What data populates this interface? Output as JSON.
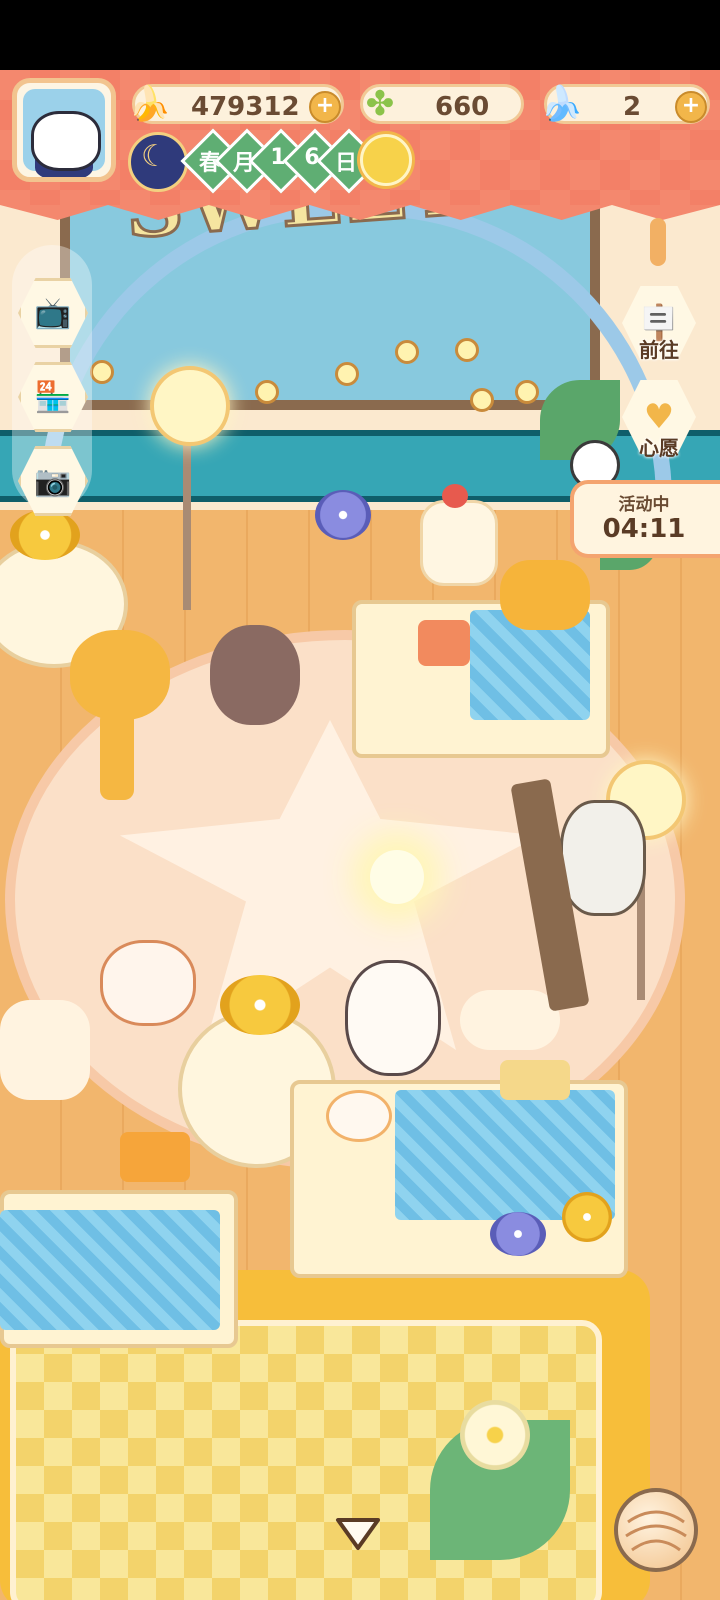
{
  "hud": {
    "avatar_icon": "cat-avatar-icon",
    "currencies": [
      {
        "name": "banana",
        "icon": "banana-icon",
        "value": "479312",
        "has_plus": true
      },
      {
        "name": "clover",
        "icon": "clover-icon",
        "value": "660",
        "has_plus": false
      },
      {
        "name": "blue-banana",
        "icon": "blue-banana-icon",
        "value": "2",
        "has_plus": true
      }
    ],
    "plus_label": "+",
    "date": {
      "season": "春",
      "month_label": "月",
      "day_digit_1": "1",
      "day_digit_2": "6",
      "day_label": "日",
      "weather_icon": "sun-icon"
    }
  },
  "left_menu": [
    {
      "name": "tv-video-button",
      "icon": "tv-icon"
    },
    {
      "name": "shop-button",
      "icon": "shop-icon"
    },
    {
      "name": "camera-button",
      "icon": "camera-icon"
    }
  ],
  "right_menu": {
    "goto_label": "前往",
    "wish_label": "心愿"
  },
  "event": {
    "title": "活动中",
    "time": "04:11"
  },
  "scene": {
    "sign_text": "SWEET"
  },
  "colors": {
    "topbar": "#f4886e",
    "wall_stripe": "#36a6b5",
    "floor": "#f2b66d",
    "accent_gold": "#f2b64a"
  }
}
